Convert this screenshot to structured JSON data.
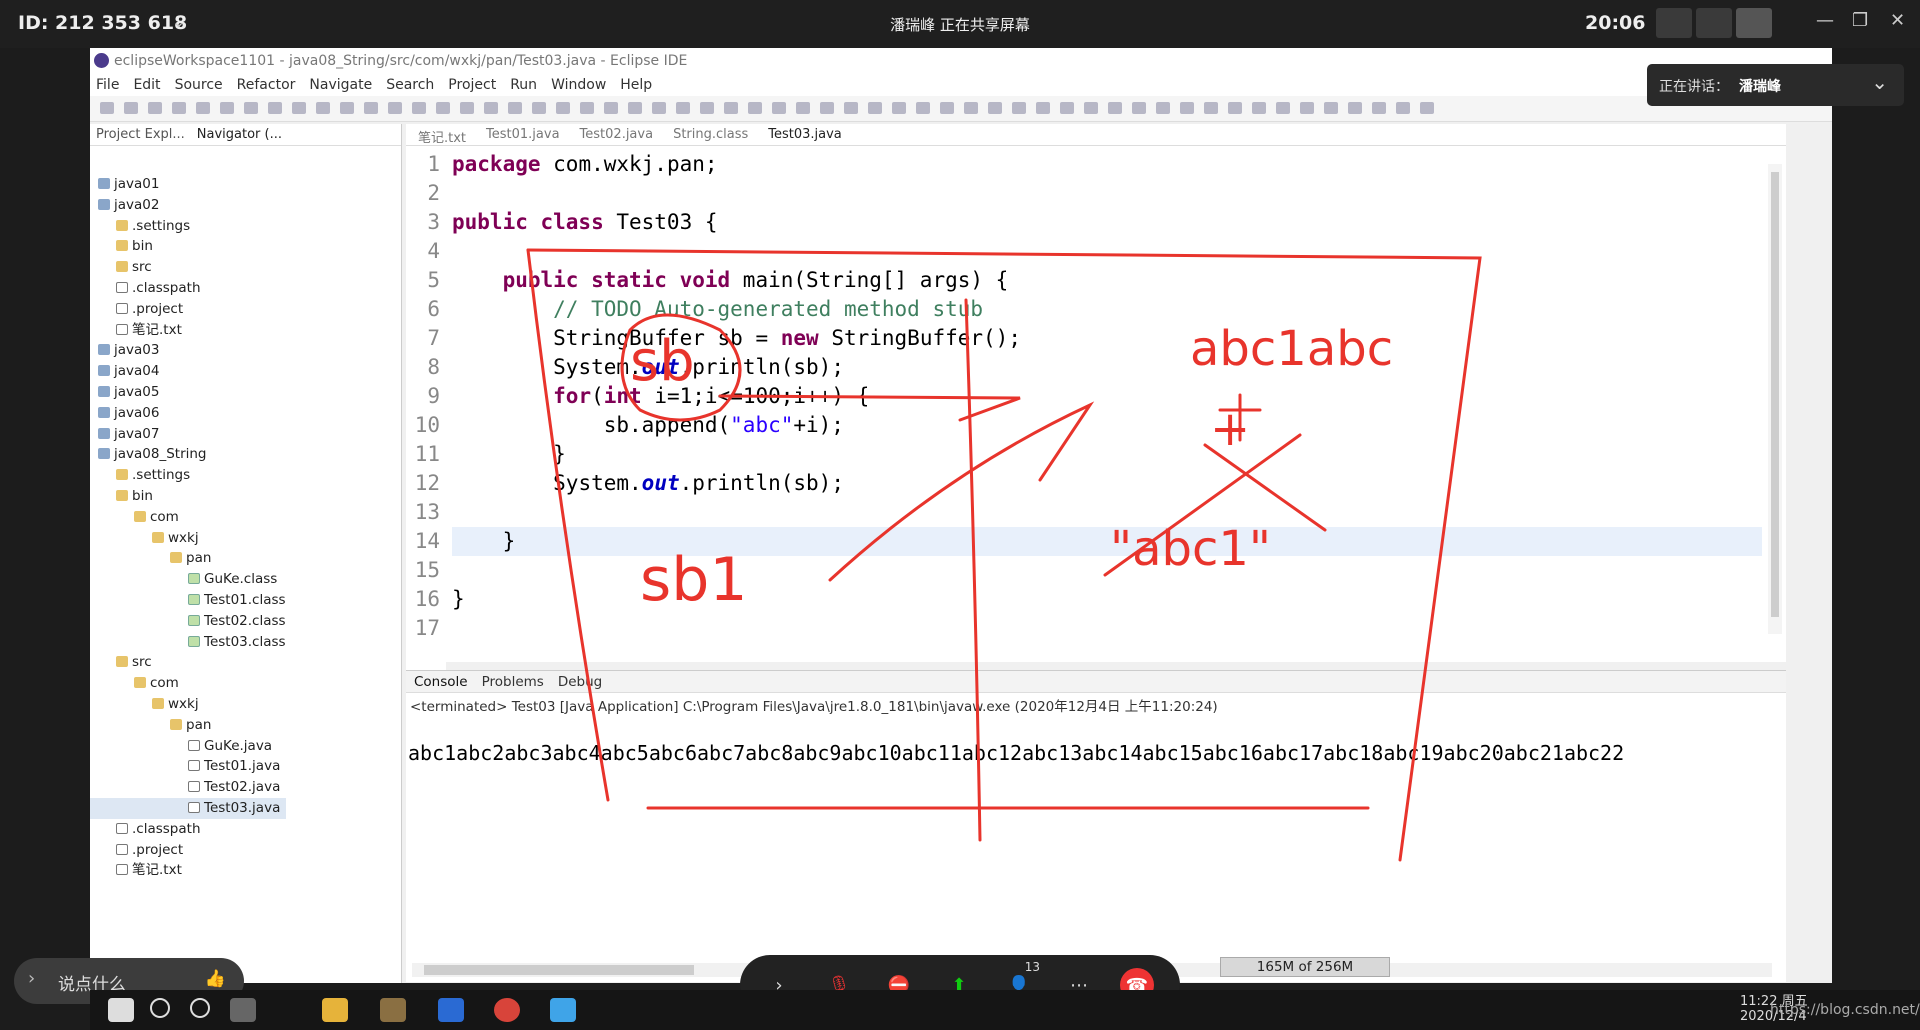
{
  "share_bar": {
    "meeting_id": "ID: 212 353 618",
    "sharing_text": "潘瑞峰 正在共享屏幕",
    "clock": "20:06"
  },
  "speaker_panel": {
    "label": "正在讲话：",
    "name": "潘瑞峰"
  },
  "window": {
    "title": "eclipseWorkspace1101 - java08_String/src/com/wxkj/pan/Test03.java - Eclipse IDE"
  },
  "menu": [
    "File",
    "Edit",
    "Source",
    "Refactor",
    "Navigate",
    "Search",
    "Project",
    "Run",
    "Window",
    "Help"
  ],
  "left_tabs": [
    "Project Expl...",
    "Navigator (..."
  ],
  "tree": [
    {
      "label": "java01",
      "depth": 0,
      "type": "proj"
    },
    {
      "label": "java02",
      "depth": 0,
      "type": "proj"
    },
    {
      "label": ".settings",
      "depth": 1,
      "type": "folder"
    },
    {
      "label": "bin",
      "depth": 1,
      "type": "folder"
    },
    {
      "label": "src",
      "depth": 1,
      "type": "folder"
    },
    {
      "label": ".classpath",
      "depth": 1,
      "type": "file"
    },
    {
      "label": ".project",
      "depth": 1,
      "type": "file"
    },
    {
      "label": "笔记.txt",
      "depth": 1,
      "type": "file"
    },
    {
      "label": "java03",
      "depth": 0,
      "type": "proj"
    },
    {
      "label": "java04",
      "depth": 0,
      "type": "proj"
    },
    {
      "label": "java05",
      "depth": 0,
      "type": "proj"
    },
    {
      "label": "java06",
      "depth": 0,
      "type": "proj"
    },
    {
      "label": "java07",
      "depth": 0,
      "type": "proj"
    },
    {
      "label": "java08_String",
      "depth": 0,
      "type": "proj"
    },
    {
      "label": ".settings",
      "depth": 1,
      "type": "folder"
    },
    {
      "label": "bin",
      "depth": 1,
      "type": "folder"
    },
    {
      "label": "com",
      "depth": 2,
      "type": "folder"
    },
    {
      "label": "wxkj",
      "depth": 3,
      "type": "folder"
    },
    {
      "label": "pan",
      "depth": 4,
      "type": "folder"
    },
    {
      "label": "GuKe.class",
      "depth": 5,
      "type": "cls"
    },
    {
      "label": "Test01.class",
      "depth": 5,
      "type": "cls"
    },
    {
      "label": "Test02.class",
      "depth": 5,
      "type": "cls"
    },
    {
      "label": "Test03.class",
      "depth": 5,
      "type": "cls"
    },
    {
      "label": "src",
      "depth": 1,
      "type": "folder"
    },
    {
      "label": "com",
      "depth": 2,
      "type": "folder"
    },
    {
      "label": "wxkj",
      "depth": 3,
      "type": "folder"
    },
    {
      "label": "pan",
      "depth": 4,
      "type": "folder"
    },
    {
      "label": "GuKe.java",
      "depth": 5,
      "type": "file"
    },
    {
      "label": "Test01.java",
      "depth": 5,
      "type": "file"
    },
    {
      "label": "Test02.java",
      "depth": 5,
      "type": "file"
    },
    {
      "label": "Test03.java",
      "depth": 5,
      "type": "file",
      "selected": true
    },
    {
      "label": ".classpath",
      "depth": 1,
      "type": "file"
    },
    {
      "label": ".project",
      "depth": 1,
      "type": "file"
    },
    {
      "label": "笔记.txt",
      "depth": 1,
      "type": "file"
    }
  ],
  "editor_tabs": [
    "笔记.txt",
    "Test01.java",
    "Test02.java",
    "String.class",
    "Test03.java"
  ],
  "line_numbers": [
    "1",
    "2",
    "3",
    "4",
    "5",
    "6",
    "7",
    "8",
    "9",
    "10",
    "11",
    "12",
    "13",
    "14",
    "15",
    "16",
    "17"
  ],
  "code": {
    "l1_kw": "package",
    "l1_rest": " com.wxkj.pan;",
    "l3_kw": "public class",
    "l3_rest": " Test03 {",
    "l5_kw": "public static void",
    "l5_rest": " main(String[] args) {",
    "l6_cm": "// TODO Auto-generated method stub",
    "l7_a": "StringBuffer sb = ",
    "l7_kw": "new",
    "l7_b": " StringBuffer();",
    "l8_a": "System.",
    "l8_fld": "out",
    "l8_b": ".println(sb);",
    "l9_kw1": "for",
    "l9_a": "(",
    "l9_kw2": "int",
    "l9_b": " i=1;i<=100;i++) {",
    "l10_a": "sb.append(",
    "l10_st": "\"abc\"",
    "l10_b": "+i);",
    "l11": "}",
    "l12_a": "System.",
    "l12_fld": "out",
    "l12_b": ".println(sb);",
    "l14": "}",
    "l16": "}"
  },
  "console": {
    "tabs": [
      "Console",
      "Problems",
      "Debug"
    ],
    "status": "<terminated> Test03 [Java Application] C:\\Program Files\\Java\\jre1.8.0_181\\bin\\javaw.exe (2020年12月4日 上午11:20:24)",
    "output": "abc1abc2abc3abc4abc5abc6abc7abc8abc9abc10abc11abc12abc13abc14abc15abc16abc17abc18abc19abc20abc21abc22"
  },
  "memory": "165M of 256M",
  "chat_placeholder": "说点什么",
  "participants_count": "13",
  "tray": {
    "time": "11:22 周五",
    "date": "2020/12/4"
  },
  "watermark": "https://blog.csdn.net/fireflyjq",
  "annotation_text": [
    "abc1abc",
    "+",
    "\"abc1\"",
    "sb1",
    "sb"
  ]
}
